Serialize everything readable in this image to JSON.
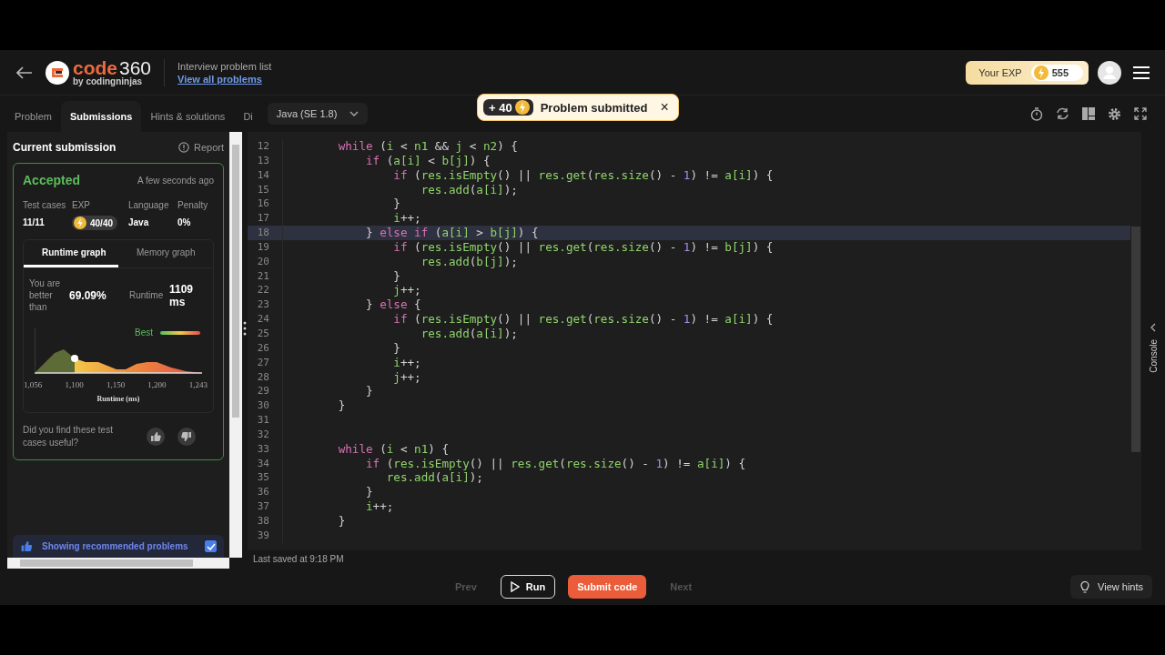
{
  "header": {
    "brand": {
      "word": "code",
      "number": "360",
      "byline": "by codingninjas"
    },
    "problem_list": {
      "title": "Interview problem list",
      "link": "View all problems"
    },
    "exp": {
      "label": "Your EXP",
      "value": "555"
    }
  },
  "tabs": [
    {
      "label": "Problem",
      "selected": false
    },
    {
      "label": "Submissions",
      "selected": true
    },
    {
      "label": "Hints & solutions",
      "selected": false
    },
    {
      "label": "Di",
      "selected": false
    }
  ],
  "language_select": {
    "value": "Java (SE 1.8)"
  },
  "toast": {
    "points": "+ 40",
    "message": "Problem submitted",
    "close": "×"
  },
  "submission": {
    "title": "Current submission",
    "report": "Report",
    "status": "Accepted",
    "time": "A few seconds ago",
    "stats": [
      {
        "label": "Test cases",
        "value": "11/11",
        "kind": "text"
      },
      {
        "label": "EXP",
        "value": "40/40",
        "kind": "exp"
      },
      {
        "label": "Language",
        "value": "Java",
        "kind": "text"
      },
      {
        "label": "Penalty",
        "value": "0%",
        "kind": "text"
      }
    ],
    "graph_tabs": [
      {
        "label": "Runtime graph",
        "selected": true
      },
      {
        "label": "Memory graph",
        "selected": false
      }
    ],
    "better_label": "You are better than",
    "better_value": "69.09%",
    "runtime_label": "Runtime",
    "runtime_value": "1109 ms",
    "legend": "Best",
    "xticks": [
      "1,056",
      "1,100",
      "1,150",
      "1,200",
      "1,243"
    ],
    "xlabel": "Runtime (ms)",
    "feedback": "Did you find these test cases useful?"
  },
  "recommended": {
    "label": "Showing recommended problems",
    "checked": true
  },
  "code_lines": [
    {
      "number": "12",
      "current": false,
      "segments": [
        {
          "kind": "keyword",
          "text": "        while"
        },
        {
          "kind": "punct",
          "text": " ("
        },
        {
          "kind": "ident",
          "text": "i"
        },
        {
          "kind": "punct",
          "text": " < "
        },
        {
          "kind": "ident",
          "text": "n1"
        },
        {
          "kind": "punct",
          "text": " && "
        },
        {
          "kind": "ident",
          "text": "j"
        },
        {
          "kind": "punct",
          "text": " < "
        },
        {
          "kind": "ident",
          "text": "n2"
        },
        {
          "kind": "punct",
          "text": ") {"
        }
      ]
    },
    {
      "number": "13",
      "current": false,
      "segments": [
        {
          "kind": "keyword",
          "text": "            if"
        },
        {
          "kind": "punct",
          "text": " ("
        },
        {
          "kind": "ident",
          "text": "a[i]"
        },
        {
          "kind": "punct",
          "text": " < "
        },
        {
          "kind": "ident",
          "text": "b[j]"
        },
        {
          "kind": "punct",
          "text": ") {"
        }
      ]
    },
    {
      "number": "14",
      "current": false,
      "segments": [
        {
          "kind": "keyword",
          "text": "                if"
        },
        {
          "kind": "punct",
          "text": " ("
        },
        {
          "kind": "ident",
          "text": "res.isEmpty"
        },
        {
          "kind": "punct",
          "text": "() || "
        },
        {
          "kind": "ident",
          "text": "res.get"
        },
        {
          "kind": "punct",
          "text": "("
        },
        {
          "kind": "ident",
          "text": "res.size"
        },
        {
          "kind": "punct",
          "text": "() - "
        },
        {
          "kind": "number",
          "text": "1"
        },
        {
          "kind": "punct",
          "text": ") != "
        },
        {
          "kind": "ident",
          "text": "a[i]"
        },
        {
          "kind": "punct",
          "text": ") {"
        }
      ]
    },
    {
      "number": "15",
      "current": false,
      "segments": [
        {
          "kind": "ident",
          "text": "                    res.add"
        },
        {
          "kind": "punct",
          "text": "("
        },
        {
          "kind": "ident",
          "text": "a[i]"
        },
        {
          "kind": "punct",
          "text": ");"
        }
      ]
    },
    {
      "number": "16",
      "current": false,
      "segments": [
        {
          "kind": "punct",
          "text": "                }"
        }
      ]
    },
    {
      "number": "17",
      "current": false,
      "segments": [
        {
          "kind": "ident",
          "text": "                i"
        },
        {
          "kind": "punct",
          "text": "++;"
        }
      ]
    },
    {
      "number": "18",
      "current": true,
      "segments": [
        {
          "kind": "punct",
          "text": "            }"
        },
        {
          "kind": "keyword",
          "text": " else if"
        },
        {
          "kind": "punct",
          "text": " ("
        },
        {
          "kind": "ident",
          "text": "a[i]"
        },
        {
          "kind": "punct",
          "text": " > "
        },
        {
          "kind": "ident",
          "text": "b[j]"
        },
        {
          "kind": "punct",
          "text": ") {"
        }
      ]
    },
    {
      "number": "19",
      "current": false,
      "segments": [
        {
          "kind": "keyword",
          "text": "                if"
        },
        {
          "kind": "punct",
          "text": " ("
        },
        {
          "kind": "ident",
          "text": "res.isEmpty"
        },
        {
          "kind": "punct",
          "text": "() || "
        },
        {
          "kind": "ident",
          "text": "res.get"
        },
        {
          "kind": "punct",
          "text": "("
        },
        {
          "kind": "ident",
          "text": "res.size"
        },
        {
          "kind": "punct",
          "text": "() - "
        },
        {
          "kind": "number",
          "text": "1"
        },
        {
          "kind": "punct",
          "text": ") != "
        },
        {
          "kind": "ident",
          "text": "b[j]"
        },
        {
          "kind": "punct",
          "text": ") {"
        }
      ]
    },
    {
      "number": "20",
      "current": false,
      "segments": [
        {
          "kind": "ident",
          "text": "                    res.add"
        },
        {
          "kind": "punct",
          "text": "("
        },
        {
          "kind": "ident",
          "text": "b[j]"
        },
        {
          "kind": "punct",
          "text": ");"
        }
      ]
    },
    {
      "number": "21",
      "current": false,
      "segments": [
        {
          "kind": "punct",
          "text": "                }"
        }
      ]
    },
    {
      "number": "22",
      "current": false,
      "segments": [
        {
          "kind": "ident",
          "text": "                j"
        },
        {
          "kind": "punct",
          "text": "++;"
        }
      ]
    },
    {
      "number": "23",
      "current": false,
      "segments": [
        {
          "kind": "punct",
          "text": "            }"
        },
        {
          "kind": "keyword",
          "text": " else"
        },
        {
          "kind": "punct",
          "text": " {"
        }
      ]
    },
    {
      "number": "24",
      "current": false,
      "segments": [
        {
          "kind": "keyword",
          "text": "                if"
        },
        {
          "kind": "punct",
          "text": " ("
        },
        {
          "kind": "ident",
          "text": "res.isEmpty"
        },
        {
          "kind": "punct",
          "text": "() || "
        },
        {
          "kind": "ident",
          "text": "res.get"
        },
        {
          "kind": "punct",
          "text": "("
        },
        {
          "kind": "ident",
          "text": "res.size"
        },
        {
          "kind": "punct",
          "text": "() - "
        },
        {
          "kind": "number",
          "text": "1"
        },
        {
          "kind": "punct",
          "text": ") != "
        },
        {
          "kind": "ident",
          "text": "a[i]"
        },
        {
          "kind": "punct",
          "text": ") {"
        }
      ]
    },
    {
      "number": "25",
      "current": false,
      "segments": [
        {
          "kind": "ident",
          "text": "                    res.add"
        },
        {
          "kind": "punct",
          "text": "("
        },
        {
          "kind": "ident",
          "text": "a[i]"
        },
        {
          "kind": "punct",
          "text": ");"
        }
      ]
    },
    {
      "number": "26",
      "current": false,
      "segments": [
        {
          "kind": "punct",
          "text": "                }"
        }
      ]
    },
    {
      "number": "27",
      "current": false,
      "segments": [
        {
          "kind": "ident",
          "text": "                i"
        },
        {
          "kind": "punct",
          "text": "++;"
        }
      ]
    },
    {
      "number": "28",
      "current": false,
      "segments": [
        {
          "kind": "ident",
          "text": "                j"
        },
        {
          "kind": "punct",
          "text": "++;"
        }
      ]
    },
    {
      "number": "29",
      "current": false,
      "segments": [
        {
          "kind": "punct",
          "text": "            }"
        }
      ]
    },
    {
      "number": "30",
      "current": false,
      "segments": [
        {
          "kind": "punct",
          "text": "        }"
        }
      ]
    },
    {
      "number": "31",
      "current": false
    },
    {
      "number": "32",
      "current": false
    },
    {
      "number": "33",
      "current": false,
      "segments": [
        {
          "kind": "keyword",
          "text": "        while"
        },
        {
          "kind": "punct",
          "text": " ("
        },
        {
          "kind": "ident",
          "text": "i"
        },
        {
          "kind": "punct",
          "text": " < "
        },
        {
          "kind": "ident",
          "text": "n1"
        },
        {
          "kind": "punct",
          "text": ") {"
        }
      ]
    },
    {
      "number": "34",
      "current": false,
      "segments": [
        {
          "kind": "keyword",
          "text": "            if"
        },
        {
          "kind": "punct",
          "text": " ("
        },
        {
          "kind": "ident",
          "text": "res.isEmpty"
        },
        {
          "kind": "punct",
          "text": "() || "
        },
        {
          "kind": "ident",
          "text": "res.get"
        },
        {
          "kind": "punct",
          "text": "("
        },
        {
          "kind": "ident",
          "text": "res.size"
        },
        {
          "kind": "punct",
          "text": "() - "
        },
        {
          "kind": "number",
          "text": "1"
        },
        {
          "kind": "punct",
          "text": ") != "
        },
        {
          "kind": "ident",
          "text": "a[i]"
        },
        {
          "kind": "punct",
          "text": ") {"
        }
      ]
    },
    {
      "number": "35",
      "current": false,
      "segments": [
        {
          "kind": "ident",
          "text": "               res.add"
        },
        {
          "kind": "punct",
          "text": "("
        },
        {
          "kind": "ident",
          "text": "a[i]"
        },
        {
          "kind": "punct",
          "text": ");"
        }
      ]
    },
    {
      "number": "36",
      "current": false,
      "segments": [
        {
          "kind": "punct",
          "text": "            }"
        }
      ]
    },
    {
      "number": "37",
      "current": false,
      "segments": [
        {
          "kind": "ident",
          "text": "            i"
        },
        {
          "kind": "punct",
          "text": "++;"
        }
      ]
    },
    {
      "number": "38",
      "current": false,
      "segments": [
        {
          "kind": "punct",
          "text": "        }"
        }
      ]
    },
    {
      "number": "39",
      "current": false
    }
  ],
  "console": {
    "label": "Console"
  },
  "last_saved": "Last saved at 9:18 PM",
  "actions": [
    {
      "label": "Prev",
      "kind": "nav",
      "disabled": true
    },
    {
      "label": "Run",
      "kind": "run",
      "disabled": false
    },
    {
      "label": "Submit code",
      "kind": "submit",
      "disabled": false
    },
    {
      "label": "Next",
      "kind": "nav",
      "disabled": true
    }
  ],
  "hints_button": {
    "label": "View hints"
  }
}
